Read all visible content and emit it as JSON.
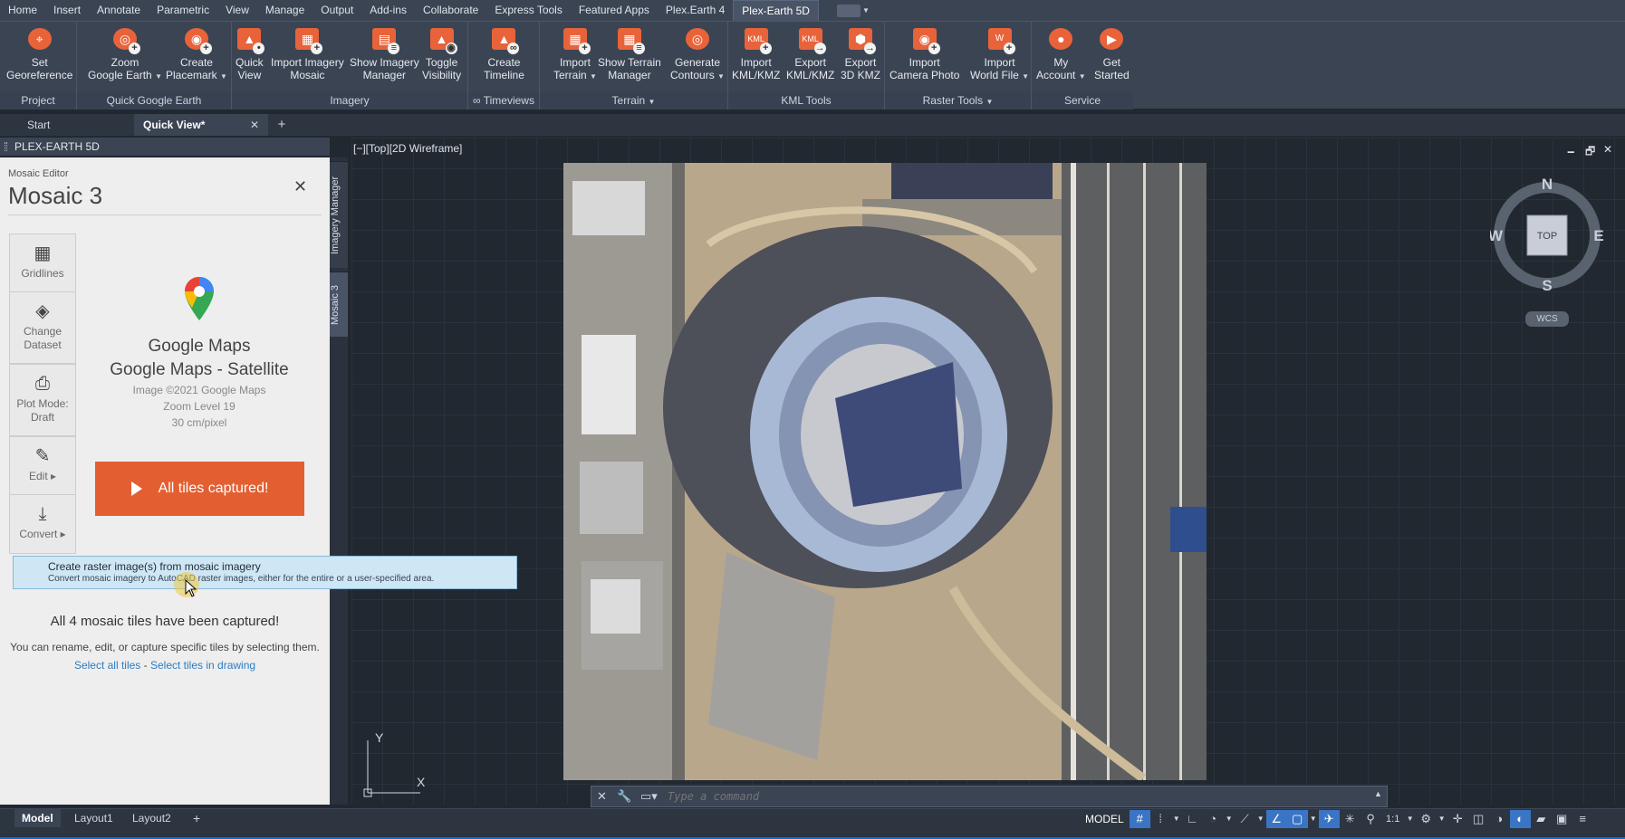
{
  "menu": {
    "tabs": [
      "Home",
      "Insert",
      "Annotate",
      "Parametric",
      "View",
      "Manage",
      "Output",
      "Add-ins",
      "Collaborate",
      "Express Tools",
      "Featured Apps",
      "Plex.Earth 4",
      "Plex-Earth 5D"
    ],
    "active": "Plex-Earth 5D"
  },
  "ribbon": {
    "panels": {
      "project": "Project",
      "quick_google_earth": "Quick Google Earth",
      "imagery": "Imagery",
      "timeviews": "∞ Timeviews",
      "terrain": "Terrain",
      "kml_tools": "KML Tools",
      "raster_tools": "Raster Tools",
      "service": "Service"
    },
    "tools": {
      "set_georeference": [
        "Set",
        "Georeference"
      ],
      "zoom_google_earth": [
        "Zoom",
        "Google Earth"
      ],
      "create_placemark": [
        "Create",
        "Placemark"
      ],
      "quick_view": [
        "Quick",
        "View"
      ],
      "import_imagery_mosaic": [
        "Import Imagery",
        "Mosaic"
      ],
      "show_imagery_manager": [
        "Show Imagery",
        "Manager"
      ],
      "toggle_visibility": [
        "Toggle",
        "Visibility"
      ],
      "create_timeline": [
        "Create",
        "Timeline"
      ],
      "import_terrain": [
        "Import",
        "Terrain"
      ],
      "show_terrain_manager": [
        "Show Terrain",
        "Manager"
      ],
      "generate_contours": [
        "Generate",
        "Contours"
      ],
      "import_kml": [
        "Import",
        "KML/KMZ"
      ],
      "export_kml": [
        "Export",
        "KML/KMZ"
      ],
      "export_3d_kmz": [
        "Export",
        "3D KMZ"
      ],
      "import_camera_photo": [
        "Import",
        "Camera Photo"
      ],
      "import_world_file": [
        "Import",
        "World File"
      ],
      "my_account": [
        "My",
        "Account"
      ],
      "get_started": [
        "Get",
        "Started"
      ]
    }
  },
  "doc_tabs": {
    "start": "Start",
    "quick_view": "Quick View*",
    "close": "✕",
    "add": "+"
  },
  "palette": {
    "title": "PLEX-EARTH 5D",
    "vtabs": [
      "Imagery Manager",
      "Mosaic 3"
    ],
    "subtitle": "Mosaic Editor",
    "heading": "Mosaic 3",
    "close": "✕",
    "side_buttons": {
      "gridlines": "Gridlines",
      "change_dataset": [
        "Change",
        "Dataset"
      ],
      "plot_mode": [
        "Plot Mode:",
        "Draft"
      ],
      "edit": "Edit ▸",
      "convert": "Convert ▸"
    },
    "provider": "Google Maps",
    "dataset": "Google Maps - Satellite",
    "copyright": "Image ©2021 Google Maps",
    "zoom": "Zoom Level 19",
    "resolution": "30 cm/pixel",
    "action_button": "All tiles captured!",
    "captured_msg": "All 4 mosaic tiles have been captured!",
    "hint": "You can rename, edit, or capture specific tiles by selecting them.",
    "link_select_all": "Select all tiles",
    "link_sep": " - ",
    "link_select_drawing": "Select tiles in drawing"
  },
  "tooltip": {
    "title": "Create raster image(s) from mosaic imagery",
    "description": "Convert mosaic imagery to AutoCAD raster images, either for the entire or a user-specified area."
  },
  "viewport": {
    "label": "[−][Top][2D Wireframe]",
    "win_min": "🗕",
    "win_restore": "🗗",
    "win_close": "✕",
    "compass": {
      "n": "N",
      "s": "S",
      "e": "E",
      "w": "W",
      "face": "TOP"
    },
    "wcs": "WCS",
    "ucs_x": "X",
    "ucs_y": "Y"
  },
  "command": {
    "placeholder": "Type a command"
  },
  "statusbar": {
    "layouts": [
      "Model",
      "Layout1",
      "Layout2"
    ],
    "add": "+",
    "model": "MODEL",
    "scale": "1:1"
  },
  "colors": {
    "accent": "#e35f32",
    "ribbon_bg": "#3b4453",
    "canvas_bg": "#212830",
    "status_blue": "#0d6fd1"
  }
}
